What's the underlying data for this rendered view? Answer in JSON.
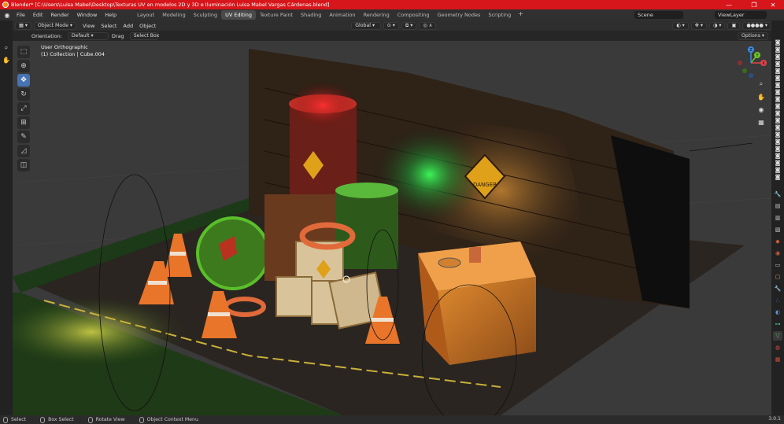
{
  "window": {
    "title": "Blender* [C:\\Users\\Luisa Mabel\\Desktop\\Texturas UV en modelos 2D y 3D e Iluminación Luisa Mabel Vargas Cárdenas.blend]",
    "minimize": "—",
    "maximize": "❐",
    "close": "✕"
  },
  "menu": {
    "items": [
      "File",
      "Edit",
      "Render",
      "Window",
      "Help"
    ],
    "workspaces": [
      "Layout",
      "Modeling",
      "Sculpting",
      "UV Editing",
      "Texture Paint",
      "Shading",
      "Animation",
      "Rendering",
      "Compositing",
      "Geometry Nodes",
      "Scripting"
    ],
    "active_workspace": "UV Editing",
    "add_workspace": "+",
    "scene": "Scene",
    "view_layer": "ViewLayer"
  },
  "header": {
    "mode": "Object Mode",
    "menus": [
      "View",
      "Select",
      "Add",
      "Object"
    ],
    "transform_orientation": "Global",
    "options": "Options"
  },
  "tool_settings": {
    "orientation_label": "Orientation:",
    "orientation_value": "Default",
    "drag_label": "Drag",
    "drag_value": "Select Box"
  },
  "viewport": {
    "view_name": "User Orthographic",
    "collection_info": "(1) Collection | Cube.004",
    "sign_text": "DANGER"
  },
  "gizmo": {
    "x": "X",
    "y": "Y",
    "z": "Z"
  },
  "status": {
    "select": "Select",
    "box_select": "Box Select",
    "rotate_view": "Rotate View",
    "context_menu": "Object Context Menu",
    "version": "3.0.1"
  },
  "colors": {
    "title_bar": "#d6161b",
    "active_tool": "#4772b3",
    "active_tab": "#4a4a4a"
  }
}
